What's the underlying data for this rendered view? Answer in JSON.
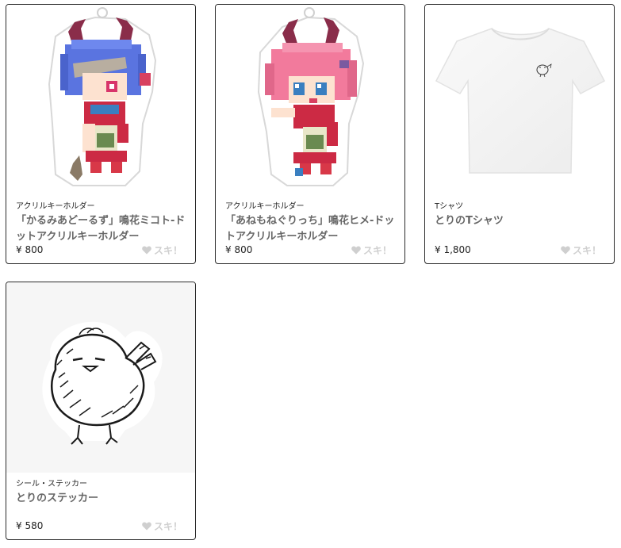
{
  "products": [
    {
      "category": "アクリルキーホルダー",
      "title": "「かるみあどーるず」鳴花ミコト-ドットアクリルキーホルダー",
      "price": "¥ 800",
      "like_label": "スキ！",
      "image": "pixel-character-blue-hair-keychain"
    },
    {
      "category": "アクリルキーホルダー",
      "title": "「あねもねぐりっち」鳴花ヒメ-ドットアクリルキーホルダー",
      "price": "¥ 800",
      "like_label": "スキ！",
      "image": "pixel-character-pink-hair-keychain"
    },
    {
      "category": "Tシャツ",
      "title": "とりのTシャツ",
      "price": "¥ 1,800",
      "like_label": "スキ！",
      "image": "white-tshirt-bird-print"
    },
    {
      "category": "シール・ステッカー",
      "title": "とりのステッカー",
      "price": "¥ 580",
      "like_label": "スキ！",
      "image": "bird-drawing-sticker"
    }
  ],
  "colors": {
    "card_border": "#2b2b2b",
    "title_text": "#666666",
    "like_inactive": "#cfcfcf"
  },
  "icons": {
    "like": "heart-icon"
  }
}
